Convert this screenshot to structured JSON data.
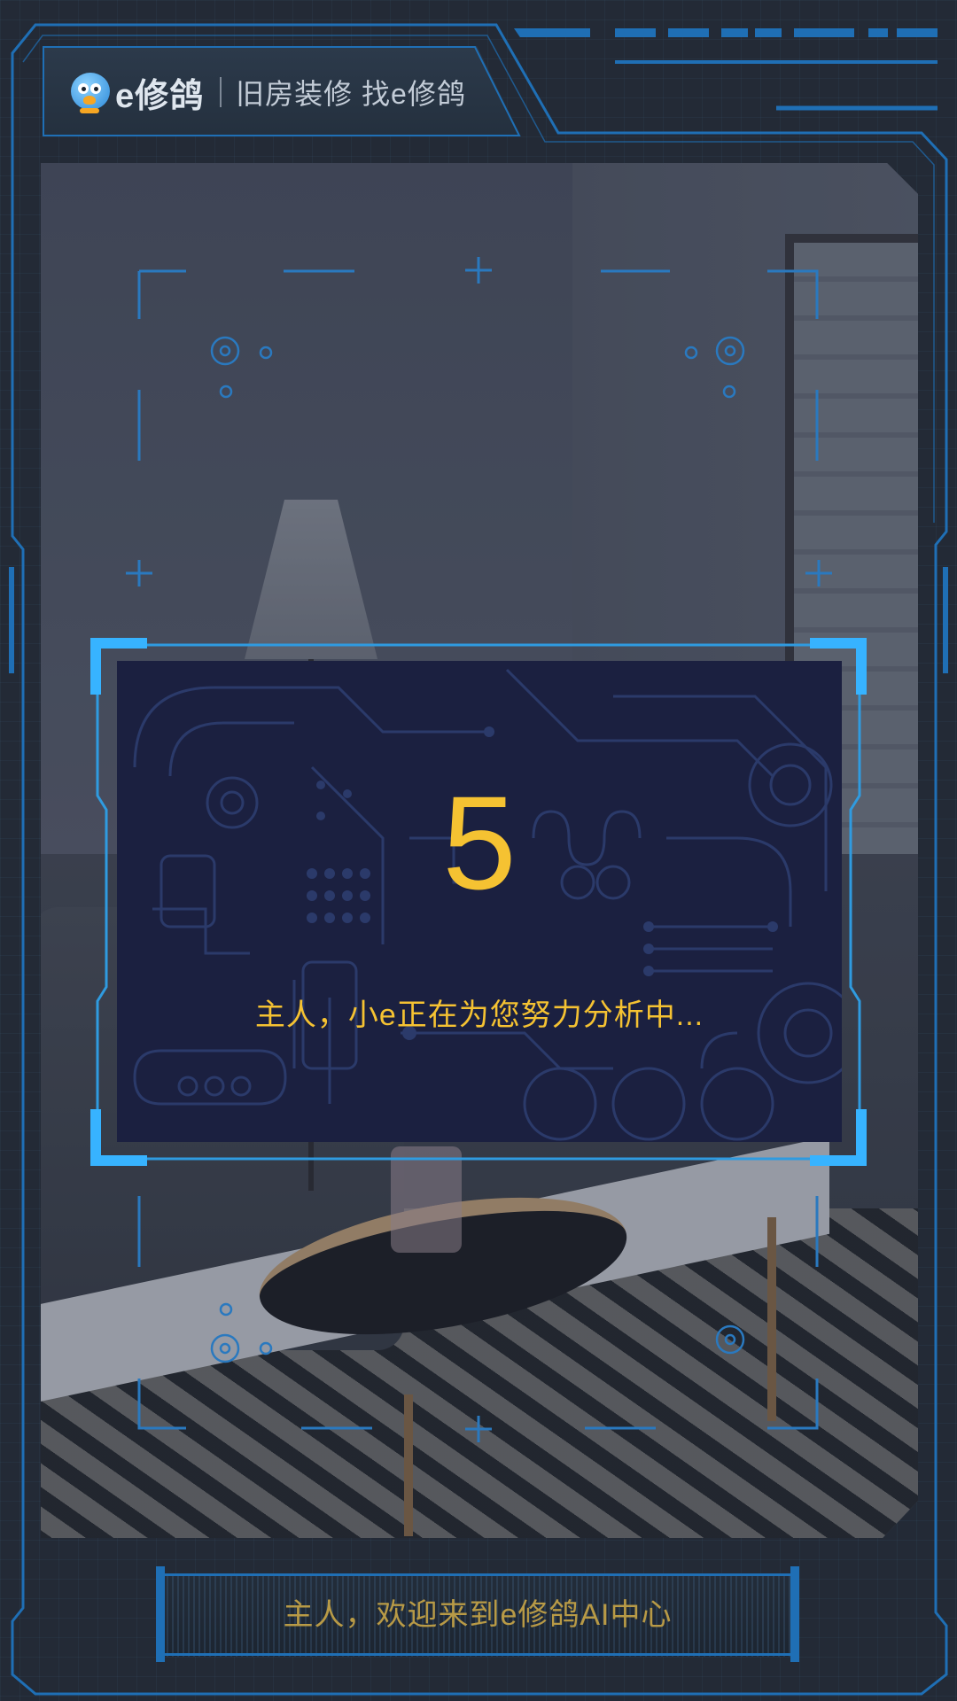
{
  "header": {
    "brand": "e修鸽",
    "slogan": "旧房装修 找e修鸽"
  },
  "card": {
    "countdown": "5",
    "message": "主人，小e正在为您努力分析中..."
  },
  "banner": {
    "text": "主人，欢迎来到e修鸽AI中心"
  },
  "colors": {
    "background": "#232a36",
    "frame_line": "#1f6fb5",
    "corner_accent": "#37b3ff",
    "card_bg": "#1b2040",
    "highlight_text": "#f5c232",
    "banner_text": "#b89a46"
  },
  "icons": [
    "pigeon-logo-icon",
    "target-reticle-icon",
    "plus-marker-icon"
  ]
}
